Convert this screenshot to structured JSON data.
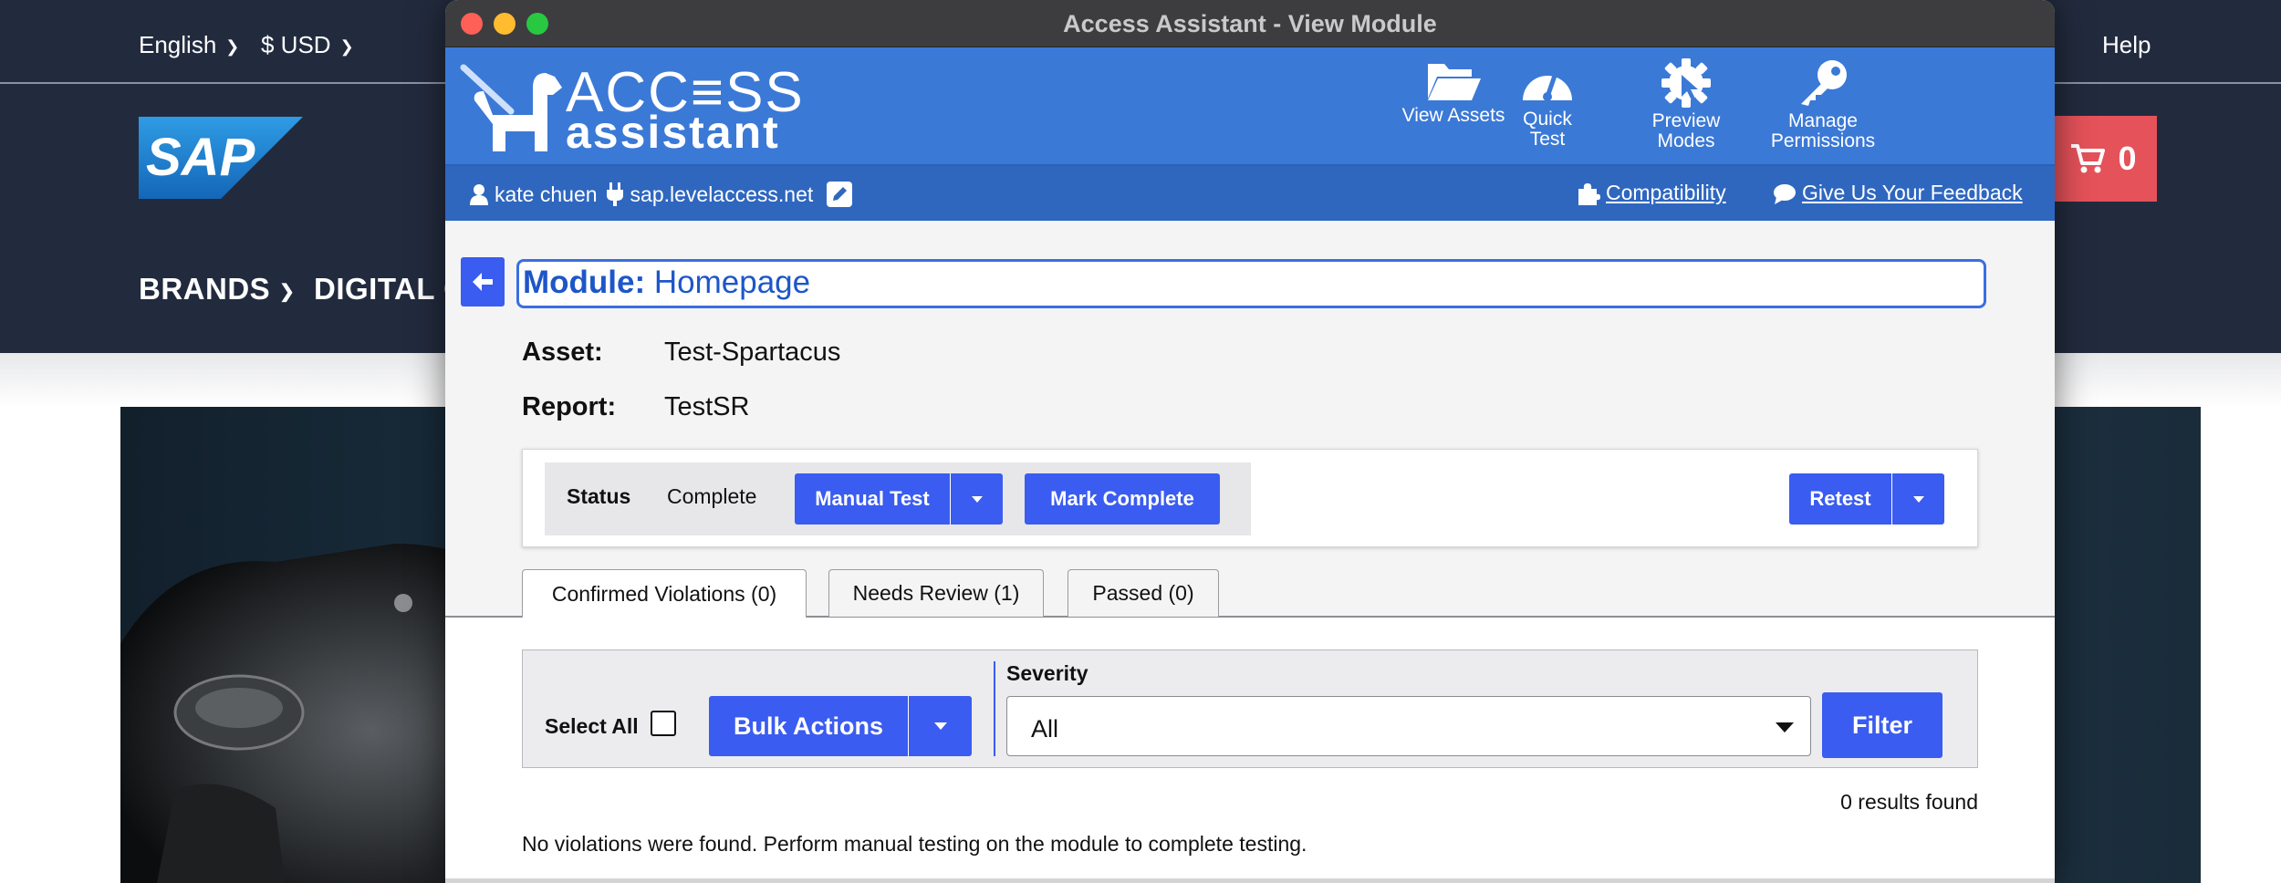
{
  "site": {
    "language": "English",
    "currency": "$ USD",
    "help": "Help",
    "logo_text": "SAP",
    "nav": [
      "BRANDS",
      "DIGITAL C"
    ],
    "cart_count": "0"
  },
  "window": {
    "title": "Access Assistant - View Module"
  },
  "header": {
    "brand_line1": "ACC≡SS",
    "brand_line2": "assistant",
    "tools": [
      {
        "label_line1": "View Assets",
        "label_line2": "",
        "icon": "folder-open-icon"
      },
      {
        "label_line1": "Quick",
        "label_line2": "Test",
        "icon": "speedometer-icon"
      },
      {
        "label_line1": "Preview",
        "label_line2": "Modes",
        "icon": "gear-cursor-icon"
      },
      {
        "label_line1": "Manage",
        "label_line2": "Permissions",
        "icon": "key-icon"
      }
    ]
  },
  "subbar": {
    "user": "kate chuen",
    "server": "sap.levelaccess.net",
    "compatibility": "Compatibility",
    "feedback": " Give Us Your Feedback"
  },
  "module": {
    "label": "Module:",
    "name": "Homepage",
    "asset_label": "Asset:",
    "asset_value": "Test-Spartacus",
    "report_label": "Report:",
    "report_value": "TestSR"
  },
  "status": {
    "label": "Status",
    "value": "Complete",
    "manual_test": "Manual Test",
    "mark_complete": "Mark Complete",
    "retest": "Retest"
  },
  "tabs": [
    {
      "label": "Confirmed Violations (0)",
      "active": true
    },
    {
      "label": "Needs Review (1)",
      "active": false
    },
    {
      "label": "Passed (0)",
      "active": false
    }
  ],
  "filters": {
    "select_all": "Select All",
    "bulk_actions": "Bulk Actions",
    "severity_label": "Severity",
    "severity_value": "All",
    "filter_button": "Filter"
  },
  "results": {
    "count_text": "0 results found",
    "message": "No violations were found. Perform manual testing on the module to complete testing."
  },
  "colors": {
    "header_blue": "#3b79d6",
    "subbar_blue": "#2f67bf",
    "button_blue": "#3a5cf0",
    "site_dark": "#222b3e",
    "cart_red": "#e5525a"
  }
}
